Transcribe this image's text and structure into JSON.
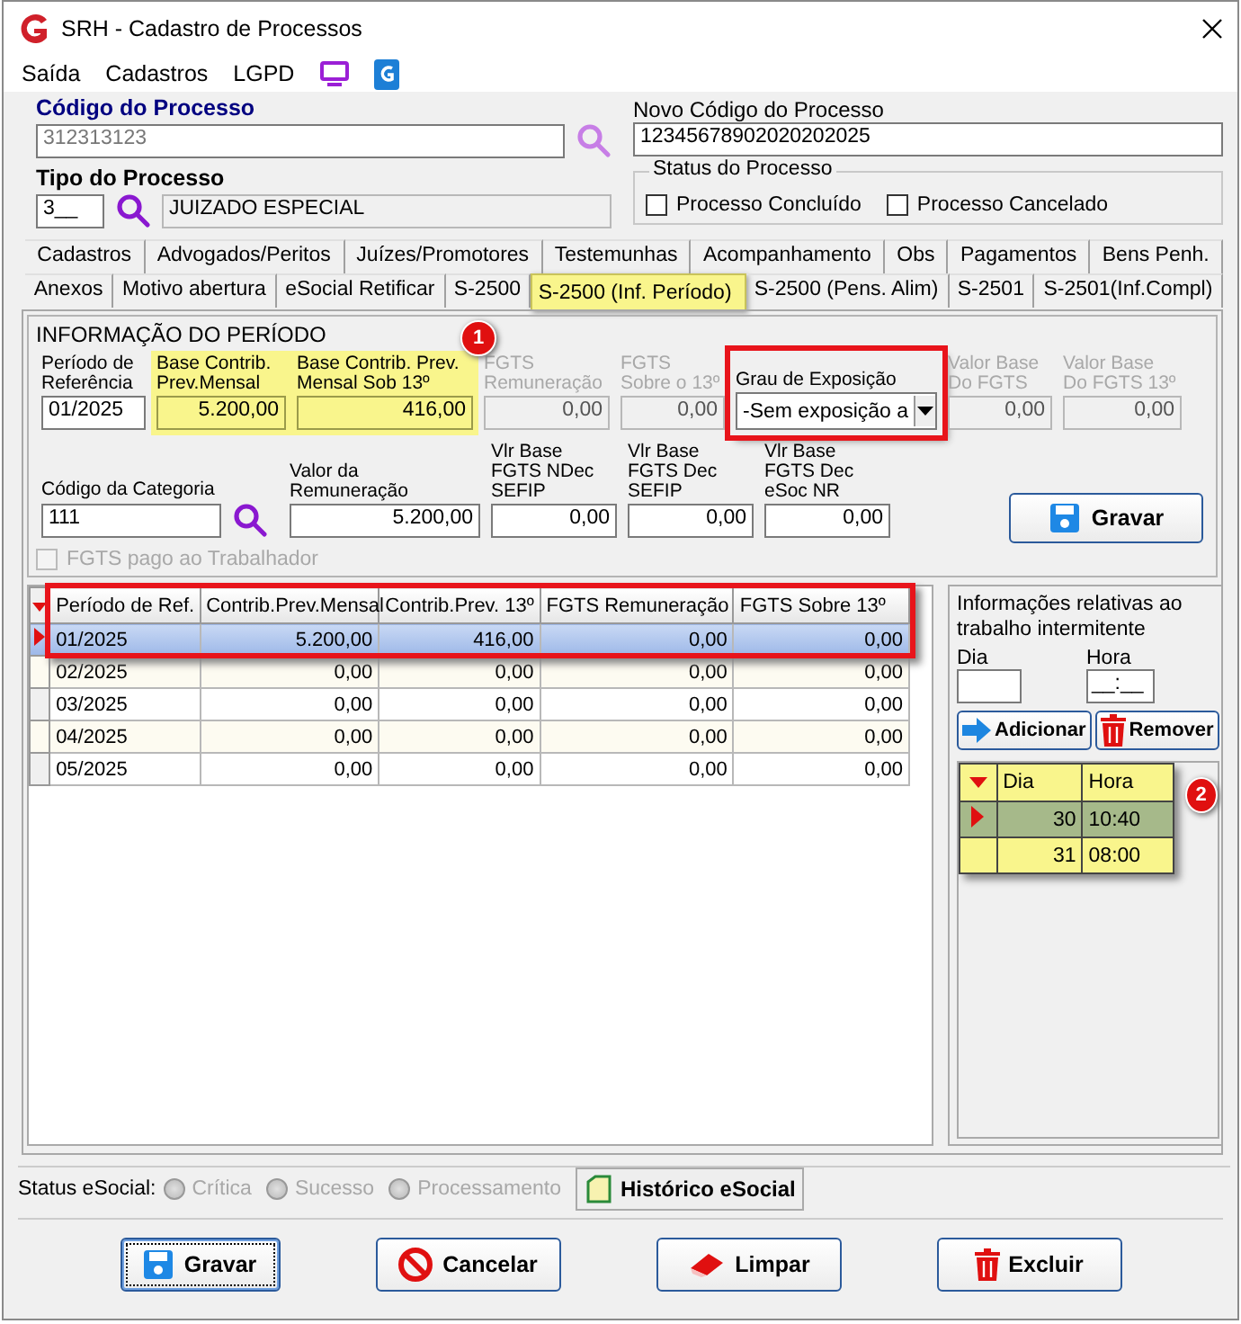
{
  "window": {
    "title": "SRH - Cadastro de Processos"
  },
  "menu": [
    "Saída",
    "Cadastros",
    "LGPD"
  ],
  "header": {
    "codigo": {
      "label": "Código do Processo",
      "value": "312313123"
    },
    "novo_codigo": {
      "label": "Novo Código do Processo",
      "value": "12345678902020202025"
    },
    "tipo": {
      "label": "Tipo do Processo",
      "code": "3__",
      "description": "JUIZADO ESPECIAL"
    },
    "status": {
      "title": "Status do Processo",
      "options": [
        {
          "label": "Processo Concluído",
          "checked": false
        },
        {
          "label": "Processo Cancelado",
          "checked": false
        }
      ]
    }
  },
  "tab_rows": [
    {
      "tabs": [
        {
          "label": "Cadastros",
          "selected": false
        },
        {
          "label": "Advogados/Peritos",
          "selected": false
        },
        {
          "label": "Juízes/Promotores",
          "selected": false
        },
        {
          "label": "Testemunhas",
          "selected": false
        },
        {
          "label": "Acompanhamento",
          "selected": false
        },
        {
          "label": "Obs",
          "selected": false
        },
        {
          "label": "Pagamentos",
          "selected": false
        },
        {
          "label": "Bens Penh.",
          "selected": false
        }
      ]
    },
    {
      "tabs": [
        {
          "label": "Anexos",
          "selected": false
        },
        {
          "label": "Motivo abertura",
          "selected": false
        },
        {
          "label": "eSocial Retificar",
          "selected": false
        },
        {
          "label": "S-2500",
          "selected": false
        },
        {
          "label": "S-2500 (Inf. Período)",
          "selected": true
        },
        {
          "label": "S-2500 (Pens. Alim)",
          "selected": false
        },
        {
          "label": "S-2501",
          "selected": false
        },
        {
          "label": "S-2501(Inf.Compl)",
          "selected": false
        }
      ]
    }
  ],
  "period_panel": {
    "title": "INFORMAÇÃO DO PERÍODO",
    "row_1": [
      {
        "kind": "date",
        "label": "Período de Referência",
        "value": "01/2025",
        "disabled": false,
        "highlighted": false
      },
      {
        "kind": "text",
        "label": "Base Contrib. Prev.Mensal",
        "value": "5.200,00",
        "disabled": false,
        "highlighted": true
      },
      {
        "kind": "text",
        "label": "Base Contrib. Prev. Mensal Sob 13º",
        "value": "416,00",
        "disabled": false,
        "highlighted": true,
        "badge": "1"
      },
      {
        "kind": "text",
        "label": "FGTS Remuneração",
        "value": "0,00",
        "disabled": true,
        "highlighted": false
      },
      {
        "kind": "text",
        "label": "FGTS Sobre o 13º",
        "value": "0,00",
        "disabled": true,
        "highlighted": false
      },
      {
        "kind": "select",
        "label": "Grau de Exposição",
        "value": "-Sem exposição a",
        "disabled": false,
        "highlighted": false,
        "framed": true
      },
      {
        "kind": "text",
        "label": "Valor Base Do FGTS",
        "value": "0,00",
        "disabled": true,
        "highlighted": false
      },
      {
        "kind": "text",
        "label": "Valor Base Do FGTS 13º",
        "value": "0,00",
        "disabled": true,
        "highlighted": false
      }
    ],
    "row_2": [
      {
        "kind": "lookup",
        "label": "Código da Categoria",
        "value": "111",
        "disabled": false,
        "highlighted": false
      },
      {
        "kind": "text",
        "label": "Valor da Remuneração",
        "value": "5.200,00",
        "disabled": false,
        "highlighted": false
      },
      {
        "kind": "text",
        "label": "Vlr Base FGTS NDec SEFIP",
        "value": "0,00",
        "disabled": false,
        "highlighted": false
      },
      {
        "kind": "text",
        "label": "Vlr Base FGTS Dec SEFIP",
        "value": "0,00",
        "disabled": false,
        "highlighted": false
      },
      {
        "kind": "text",
        "label": "Vlr Base FGTS Dec eSoc NR",
        "value": "0,00",
        "disabled": false,
        "highlighted": false
      }
    ],
    "save_button": "Gravar",
    "fgts_pago": {
      "label": "FGTS pago ao Trabalhador",
      "checked": false,
      "disabled": true
    }
  },
  "grid": {
    "framed": true,
    "columns": [
      "Período de Ref.",
      "Contrib.Prev.Mensal",
      "Contrib.Prev. 13º",
      "FGTS Remuneração",
      "FGTS Sobre 13º"
    ],
    "rows": [
      {
        "cells": [
          "01/2025",
          "5.200,00",
          "416,00",
          "0,00",
          "0,00"
        ],
        "selected": true
      },
      {
        "cells": [
          "02/2025",
          "0,00",
          "0,00",
          "0,00",
          "0,00"
        ],
        "selected": false
      },
      {
        "cells": [
          "03/2025",
          "0,00",
          "0,00",
          "0,00",
          "0,00"
        ],
        "selected": false
      },
      {
        "cells": [
          "04/2025",
          "0,00",
          "0,00",
          "0,00",
          "0,00"
        ],
        "selected": false
      },
      {
        "cells": [
          "05/2025",
          "0,00",
          "0,00",
          "0,00",
          "0,00"
        ],
        "selected": false
      }
    ]
  },
  "intermitente": {
    "title": "Informações relativas ao trabalho intermitente",
    "day_label": "Dia",
    "hour_label": "Hora",
    "hour_value": "__:__",
    "add_button": "Adicionar",
    "remove_button": "Remover",
    "grid": {
      "highlighted": true,
      "badge": "2",
      "columns": [
        "Dia",
        "Hora"
      ],
      "rows": [
        {
          "day": "30",
          "hour": "10:40",
          "selected": true
        },
        {
          "day": "31",
          "hour": "08:00",
          "selected": false
        }
      ]
    }
  },
  "status_bar": {
    "label": "Status eSocial:",
    "options": [
      {
        "label": "Crítica",
        "selected": false,
        "disabled": true
      },
      {
        "label": "Sucesso",
        "selected": false,
        "disabled": true
      },
      {
        "label": "Processamento",
        "selected": false,
        "disabled": true
      }
    ],
    "history_button": "Histórico eSocial"
  },
  "footer_buttons": [
    {
      "kind": "save",
      "label": "Gravar",
      "focused": true
    },
    {
      "kind": "cancel",
      "label": "Cancelar",
      "focused": false
    },
    {
      "kind": "clear",
      "label": "Limpar",
      "focused": false
    },
    {
      "kind": "delete",
      "label": "Excluir",
      "focused": false
    }
  ]
}
